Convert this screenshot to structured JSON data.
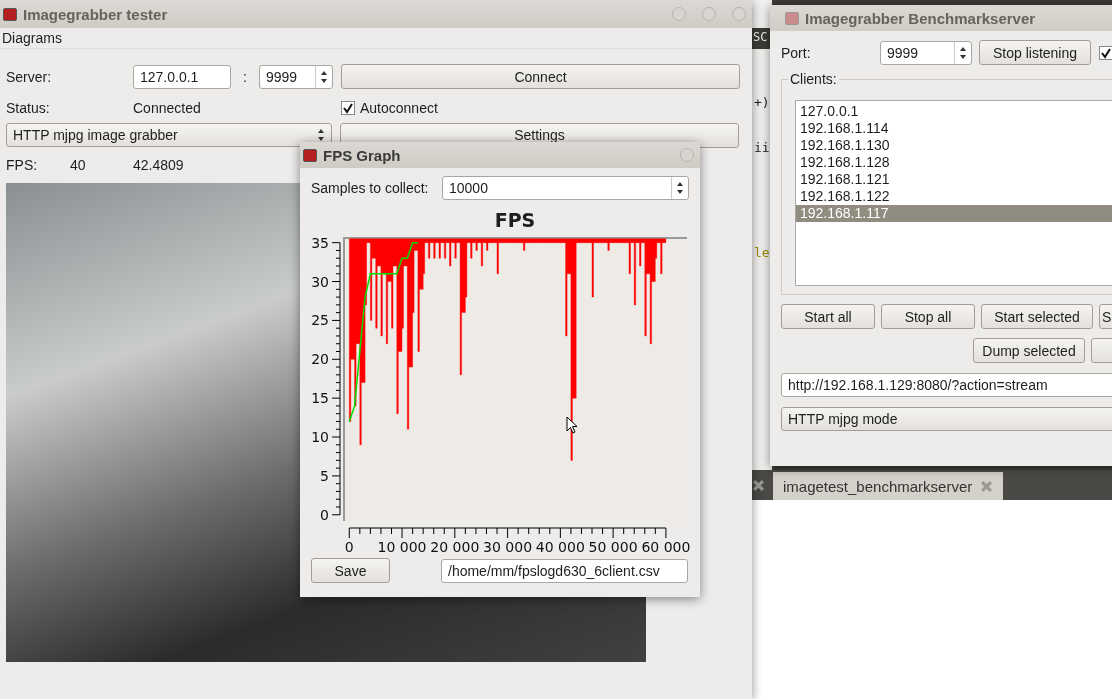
{
  "editor_fragments": [
    "SC",
    "+)",
    "ii",
    "le"
  ],
  "tester_window": {
    "title": "Imagegrabber tester",
    "menu": [
      "Diagrams"
    ],
    "server_label": "Server:",
    "server_host": "127.0.0.1",
    "separator": ":",
    "server_port": "9999",
    "connect_button": "Connect",
    "status_label": "Status:",
    "status_value": "Connected",
    "autoconnect": {
      "label": "Autoconnect",
      "checked": true
    },
    "grabber_combo": "HTTP mjpg image grabber",
    "settings_button": "Settings",
    "fps_label": "FPS:",
    "fps_target": "40",
    "fps_measured": "42.4809"
  },
  "server_window": {
    "title": "Imagegrabber Benchmarkserver",
    "port_label": "Port:",
    "port_value": "9999",
    "listen_button": "Stop listening",
    "listen_checkbox": {
      "checked": true
    },
    "clients_label": "Clients:",
    "clients": [
      {
        "address": "127.0.0.1",
        "selected": false
      },
      {
        "address": "192.168.1.114",
        "selected": false
      },
      {
        "address": "192.168.1.130",
        "selected": false
      },
      {
        "address": "192.168.1.128",
        "selected": false
      },
      {
        "address": "192.168.1.121",
        "selected": false
      },
      {
        "address": "192.168.1.122",
        "selected": false
      },
      {
        "address": "192.168.1.117",
        "selected": true
      }
    ],
    "buttons_row_1": [
      "Start all",
      "Stop all",
      "Start selected",
      "S"
    ],
    "buttons_row_2": [
      "Dump selected"
    ],
    "stream_url": "http://192.168.1.129:8080/?action=stream",
    "mode_combo": "HTTP mjpg mode"
  },
  "editor_tabs": [
    {
      "label": "imagetest_benchmarkserver",
      "selected": true
    }
  ],
  "fps_window": {
    "title": "FPS Graph",
    "samples_label": "Samples to collect:",
    "samples_value": "10000",
    "save_button": "Save",
    "file_path": "/home/mm/fpslogd630_6client.csv",
    "chart": {
      "title": "FPS",
      "y_tick_labels": [
        "35",
        "30",
        "25",
        "20",
        "15",
        "10",
        "5",
        "0"
      ],
      "x_tick_labels": [
        "0",
        "10 000",
        "20 000",
        "30 000",
        "40 000",
        "50 000",
        "60 000"
      ]
    }
  }
}
